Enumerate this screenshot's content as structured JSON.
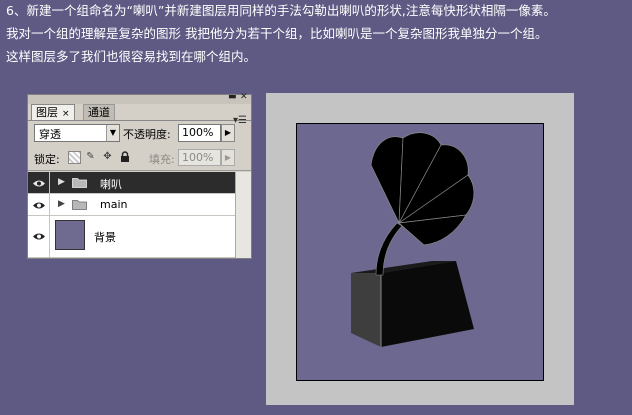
{
  "caption": {
    "line1": "6、新建一个组命名为“喇叭”并新建图层用同样的手法勾勒出喇叭的形状,注意每快形状相隔一像素。",
    "line2": "我对一个组的理解是复杂的图形 我把他分为若干个组，比如喇叭是一个复杂图形我单独分一个组。",
    "line3": "这样图层多了我们也很容易找到在哪个组内。"
  },
  "panel": {
    "tabs": [
      "图层",
      "通道"
    ],
    "tab_close": "×",
    "blend_mode": "穿透",
    "opacity_label": "不透明度:",
    "opacity_value": "100%",
    "lock_label": "锁定:",
    "fill_label": "填充:",
    "fill_value": "100%",
    "layers": [
      {
        "name": "喇叭",
        "type": "group",
        "selected": true
      },
      {
        "name": "main",
        "type": "group",
        "selected": false
      },
      {
        "name": "背景",
        "type": "layer",
        "selected": false
      }
    ]
  },
  "colors": {
    "page_bg": "#5f5a84",
    "canvas_bg": "#6d6890",
    "canvas_border": "#c4c4c4",
    "horn": "#000000",
    "box_front": "#0a0a0a",
    "box_side": "#3e3e3e"
  },
  "icons": [
    "eye-icon",
    "folder-icon",
    "expand-triangle-icon",
    "lock-transparent-icon",
    "lock-brush-icon",
    "lock-move-icon",
    "lock-all-icon",
    "panel-menu-icon"
  ]
}
